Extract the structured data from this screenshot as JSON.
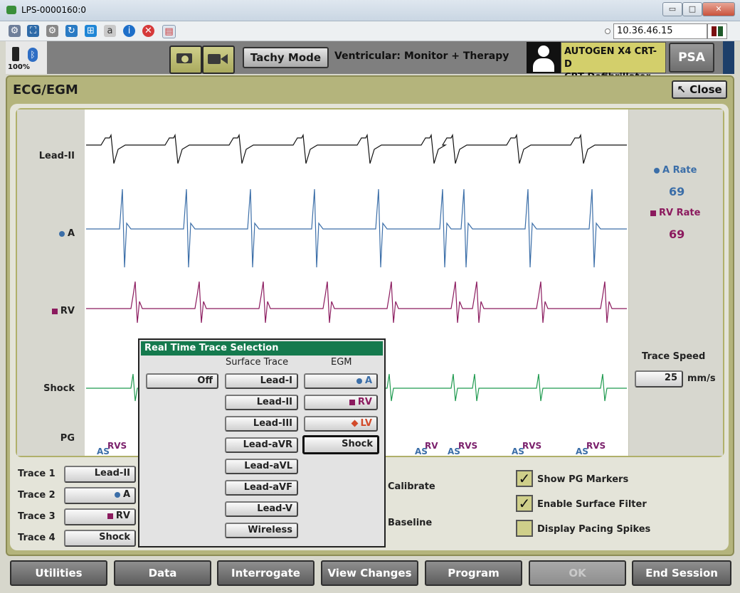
{
  "window": {
    "title": "LPS-0000160:0",
    "minimize": "▭",
    "maximize": "□",
    "close": "✕"
  },
  "toolbar": {
    "ip_address": "10.36.46.15"
  },
  "header": {
    "battery_pct": "100%",
    "tachy_mode_label": "Tachy Mode",
    "mode_text": "Ventricular: Monitor + Therapy",
    "device_line1": "AUTOGEN X4 CRT-D",
    "device_line2": "CRT Defibrillator",
    "psa_label": "PSA"
  },
  "panel": {
    "title": "ECG/EGM",
    "close_label": "Close"
  },
  "traces": {
    "labels": [
      "Lead-II",
      "A",
      "RV",
      "Shock",
      "PG"
    ],
    "colors": {
      "lead": "#111111",
      "a": "#3b6ea8",
      "rv": "#8b1a5e",
      "shock": "#1f9a4f",
      "markers": "#7a1f6b",
      "as": "#3b6ea8"
    },
    "markers_visible": [
      "AS",
      "RVS",
      "RV",
      "AS",
      "RVS",
      "AS",
      "RVS",
      "AS",
      "RVS"
    ]
  },
  "rates": {
    "a_label": "A Rate",
    "a_value": "69",
    "rv_label": "RV Rate",
    "rv_value": "69"
  },
  "trace_speed": {
    "label": "Trace Speed",
    "value": "25",
    "unit": "mm/s"
  },
  "trace_assign": [
    {
      "label": "Trace 1",
      "value": "Lead-II"
    },
    {
      "label": "Trace 2",
      "value": "A"
    },
    {
      "label": "Trace 3",
      "value": "RV"
    },
    {
      "label": "Trace 4",
      "value": "Shock"
    }
  ],
  "calibrate_label": "Calibrate",
  "baseline_label": "Baseline",
  "options": [
    {
      "label": "Show PG Markers",
      "checked": true
    },
    {
      "label": "Enable Surface Filter",
      "checked": true
    },
    {
      "label": "Display Pacing Spikes",
      "checked": false
    }
  ],
  "popup": {
    "title": "Real Time Trace Selection",
    "col_surface": "Surface Trace",
    "col_egm": "EGM",
    "off_label": "Off",
    "surface": [
      "Lead-I",
      "Lead-II",
      "Lead-III",
      "Lead-aVR",
      "Lead-aVL",
      "Lead-aVF",
      "Lead-V",
      "Wireless"
    ],
    "egm": [
      "A",
      "RV",
      "LV",
      "Shock"
    ],
    "selected": "Shock"
  },
  "nav": [
    "Utilities",
    "Data",
    "Interrogate",
    "View Changes",
    "Program",
    "OK",
    "End Session"
  ]
}
